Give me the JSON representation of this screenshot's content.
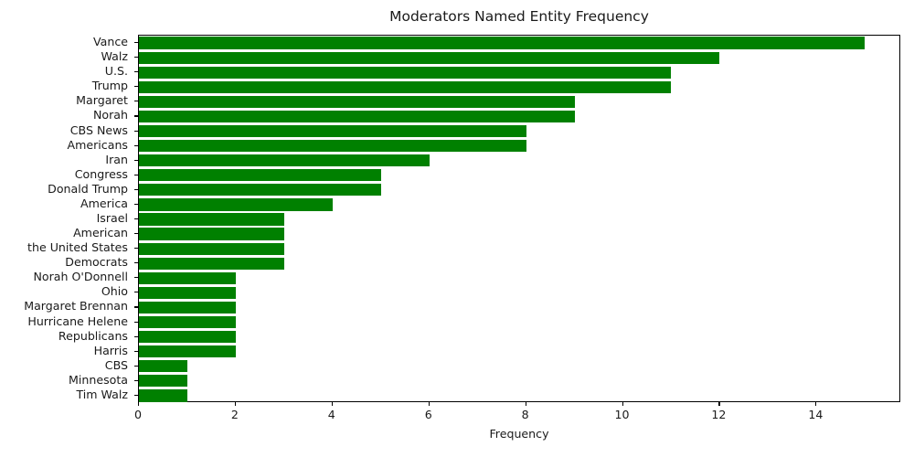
{
  "chart_data": {
    "type": "bar",
    "orientation": "horizontal",
    "title": "Moderators Named Entity Frequency",
    "xlabel": "Frequency",
    "ylabel": "",
    "categories": [
      "Vance",
      "Walz",
      "U.S.",
      "Trump",
      "Margaret",
      "Norah",
      "CBS News",
      "Americans",
      "Iran",
      "Congress",
      "Donald Trump",
      "America",
      "Israel",
      "American",
      "the United States",
      "Democrats",
      "Norah O'Donnell",
      "Ohio",
      "Margaret Brennan",
      "Hurricane Helene",
      "Republicans",
      "Harris",
      "CBS",
      "Minnesota",
      "Tim Walz"
    ],
    "values": [
      15,
      12,
      11,
      11,
      9,
      9,
      8,
      8,
      6,
      5,
      5,
      4,
      3,
      3,
      3,
      3,
      2,
      2,
      2,
      2,
      2,
      2,
      1,
      1,
      1
    ],
    "xlim": [
      0,
      15.75
    ],
    "xticks": [
      0,
      2,
      4,
      6,
      8,
      10,
      12,
      14
    ],
    "xticklabels": [
      "0",
      "2",
      "4",
      "6",
      "8",
      "10",
      "12",
      "14"
    ],
    "grid": false,
    "legend": null,
    "bar_color": "#008000",
    "background_color": "#ffffff",
    "axis_color": "#000000"
  }
}
